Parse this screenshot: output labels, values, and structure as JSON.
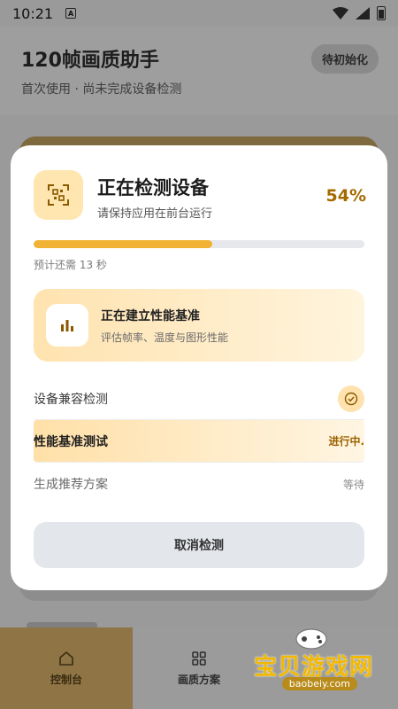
{
  "status_bar": {
    "time": "10:21",
    "notif_letter": "A"
  },
  "app": {
    "title": "120帧画质助手",
    "subtitle": "首次使用 · 尚未完成设备检测",
    "init_badge": "待初始化"
  },
  "modal": {
    "title": "正在检测设备",
    "subtitle": "请保持应用在前台运行",
    "percent_label": "54%",
    "progress_fraction": 0.54,
    "eta": "预计还需 13 秒",
    "stage": {
      "title": "正在建立性能基准",
      "desc": "评估帧率、温度与图形性能"
    },
    "steps": [
      {
        "label": "设备兼容检测",
        "status": ""
      },
      {
        "label": "性能基准测试",
        "status": "进行中."
      },
      {
        "label": "生成推荐方案",
        "status": "等待"
      }
    ],
    "cancel_label": "取消检测"
  },
  "nav": [
    {
      "label": "控制台"
    },
    {
      "label": "画质方案"
    },
    {
      "label": ""
    }
  ],
  "watermark": {
    "text": "宝贝游戏网",
    "url": "baobeiy.com"
  },
  "colors": {
    "accent": "#f2b233",
    "accent_text": "#a46a00",
    "stage_bg": "#ffe3b0"
  }
}
